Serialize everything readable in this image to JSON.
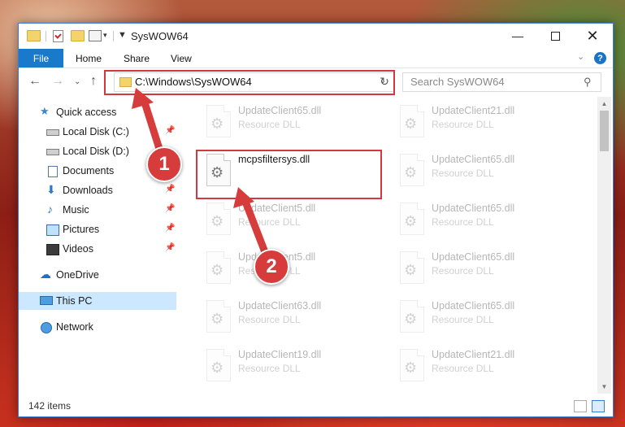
{
  "window": {
    "title": "SysWOW64"
  },
  "ribbon": {
    "tabs": [
      "File",
      "Home",
      "Share",
      "View"
    ]
  },
  "address": {
    "path": "C:\\Windows\\SysWOW64"
  },
  "search": {
    "placeholder": "Search SysWOW64"
  },
  "nav": {
    "items": [
      {
        "label": "Quick access",
        "icon": "star-icon"
      },
      {
        "label": "Local Disk (C:)",
        "icon": "disk-icon",
        "pinned": true
      },
      {
        "label": "Local Disk (D:)",
        "icon": "disk-icon"
      },
      {
        "label": "Documents",
        "icon": "documents-icon",
        "pinned": true
      },
      {
        "label": "Downloads",
        "icon": "download-icon",
        "pinned": true
      },
      {
        "label": "Music",
        "icon": "music-icon",
        "pinned": true
      },
      {
        "label": "Pictures",
        "icon": "pictures-icon",
        "pinned": true
      },
      {
        "label": "Videos",
        "icon": "videos-icon",
        "pinned": true
      },
      {
        "label": "OneDrive",
        "icon": "onedrive-icon"
      },
      {
        "label": "This PC",
        "icon": "pc-icon",
        "selected": true
      },
      {
        "label": "Network",
        "icon": "network-icon"
      }
    ]
  },
  "files": [
    {
      "name": "UpdateClient65.dll",
      "type": "Resource DLL",
      "faded": true
    },
    {
      "name": "UpdateClient21.dll",
      "type": "Resource DLL",
      "faded": true
    },
    {
      "name": "mcpsfiltersys.dll",
      "type": "",
      "faded": false
    },
    {
      "name": "UpdateClient65.dll",
      "type": "Resource DLL",
      "faded": true
    },
    {
      "name": "UpdateClient5.dll",
      "type": "Resource DLL",
      "faded": true
    },
    {
      "name": "UpdateClient65.dll",
      "type": "Resource DLL",
      "faded": true
    },
    {
      "name": "UpdateClient5.dll",
      "type": "Resource DLL",
      "faded": true
    },
    {
      "name": "UpdateClient65.dll",
      "type": "Resource DLL",
      "faded": true
    },
    {
      "name": "UpdateClient63.dll",
      "type": "Resource DLL",
      "faded": true
    },
    {
      "name": "UpdateClient65.dll",
      "type": "Resource DLL",
      "faded": true
    },
    {
      "name": "UpdateClient19.dll",
      "type": "Resource DLL",
      "faded": true
    },
    {
      "name": "UpdateClient21.dll",
      "type": "Resource DLL",
      "faded": true
    }
  ],
  "status": {
    "items_count": "142 items"
  },
  "callouts": [
    "1",
    "2"
  ],
  "colors": {
    "accent": "#1979ca",
    "highlight": "#d4373d",
    "selected": "#cce8ff"
  }
}
